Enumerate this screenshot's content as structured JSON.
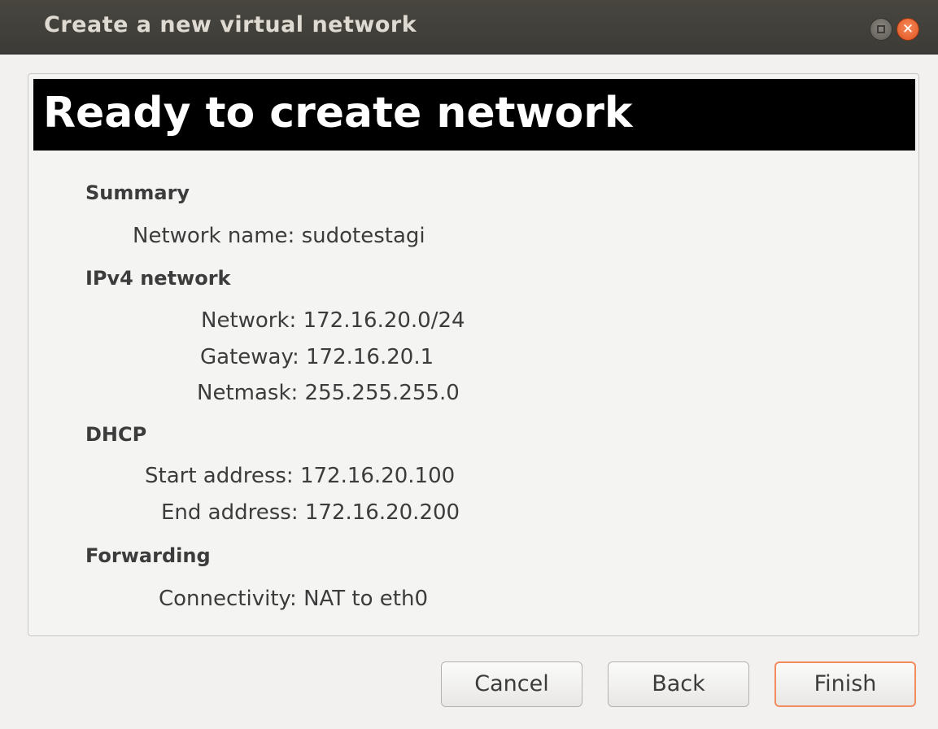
{
  "window": {
    "title": "Create a new virtual network",
    "controls": {
      "maximize_icon": "maximize-icon",
      "close_icon": "close-icon",
      "close_glyph": "✕"
    }
  },
  "header": {
    "title": "Ready to create network"
  },
  "summary": {
    "heading": "Summary",
    "network_name_label": "Network name:",
    "network_name_value": "sudotestagi"
  },
  "ipv4": {
    "heading": "IPv4 network",
    "network_label": "Network:",
    "network_value": "172.16.20.0/24",
    "gateway_label": "Gateway:",
    "gateway_value": "172.16.20.1",
    "netmask_label": "Netmask:",
    "netmask_value": "255.255.255.0"
  },
  "dhcp": {
    "heading": "DHCP",
    "start_label": "Start address:",
    "start_value": "172.16.20.100",
    "end_label": "End address:",
    "end_value": "172.16.20.200"
  },
  "forwarding": {
    "heading": "Forwarding",
    "connectivity_label": "Connectivity:",
    "connectivity_value": "NAT to eth0"
  },
  "buttons": {
    "cancel": "Cancel",
    "back": "Back",
    "finish": "Finish"
  },
  "colors": {
    "titlebar": "#3c3b37",
    "header_band": "#000000",
    "close_button": "#e0531f",
    "default_button_border": "#f28c5e"
  }
}
